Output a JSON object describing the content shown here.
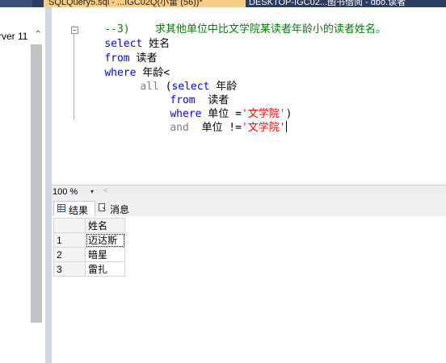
{
  "tabs": {
    "active_label": "SQLQuery5.sql - ...IGC02Q(小雷 (56))*",
    "close_glyph": "✕",
    "inactive_label": "DESKTOP-IGC02...图书借阅 - dbo.读者"
  },
  "object_explorer": {
    "server_node": "rver 11",
    "chevron": "^"
  },
  "editor": {
    "line1": {
      "comment": "--3)    求其他单位中比文学院某读者年龄小的读者姓名。"
    },
    "line2": {
      "kw": "select",
      "text": " 姓名"
    },
    "line3": {
      "kw": "from",
      "text": " 读者"
    },
    "line4": {
      "kw": "where",
      "text": " 年龄<"
    },
    "line5": {
      "gray": "all",
      "text": " (",
      "kw": "select",
      "text2": " 年龄"
    },
    "line6": {
      "kw": "from",
      "text": "  读者"
    },
    "line7": {
      "kw": "where",
      "text": " 单位 =",
      "str": "'文学院'",
      "text2": ")"
    },
    "line8": {
      "gray": "and",
      "text": "  单位 !=",
      "str": "'文学院'"
    }
  },
  "zoom": {
    "value": "100 %",
    "arrow": "▾",
    "scroll_left": "<"
  },
  "results": {
    "tab_results": "结果",
    "tab_messages": "消息",
    "columns": [
      "姓名"
    ],
    "rows": [
      {
        "num": "1",
        "name": "迈达斯"
      },
      {
        "num": "2",
        "name": "暗星"
      },
      {
        "num": "3",
        "name": "雷扎"
      }
    ]
  },
  "colors": {
    "keyword": "#0000ff",
    "comment": "#008000",
    "string": "#ff0000",
    "tab_active_bg": "#f5cc84",
    "tab_strip_bg": "#2b3d63"
  }
}
